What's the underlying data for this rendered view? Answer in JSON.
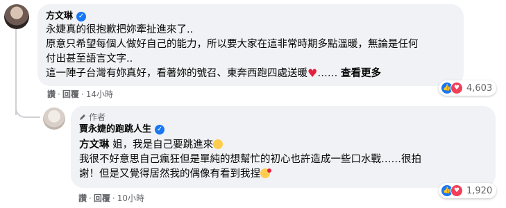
{
  "comment1": {
    "author": "方文琳",
    "lines": [
      "永婕真的很抱歉把妳牽扯進來了..",
      "原意只希望每個人做好自己的能力，所以要大家在這非常時期多點溫暖，無論是任何",
      "付出甚至語言文字..",
      "這一陣子台灣有妳真好，看著妳的號召、東奔西跑四處送暖"
    ],
    "ellipsis": "……",
    "see_more": "查看更多",
    "actions": {
      "like": "讚",
      "reply": "回覆",
      "time": "14小時"
    },
    "reaction_count": "4,603"
  },
  "reply1": {
    "badge": "作者",
    "author": "賈永婕的跑跳人生",
    "mention": "方文琳",
    "line1_rest": " 姐，我是自己要跳進來",
    "line2": "我很不好意思自己瘋狂但是單純的想幫忙的初心也許造成一些口水戰……很拍",
    "line3": "謝！但是又覺得居然我的偶像有看到我捏",
    "actions": {
      "like": "讚",
      "reply": "回覆",
      "time": "10小時"
    },
    "reaction_count": "1,920"
  },
  "colors": {
    "bubble": "#f0f2f5",
    "meta": "#65676b",
    "verified": "#1877f2",
    "love": "#f33e58"
  },
  "icons": [
    "verified-badge-icon",
    "heart-emoji-icon",
    "grin-emoji-icon",
    "kiss-emoji-icon",
    "like-reaction-icon",
    "love-reaction-icon",
    "pen-icon"
  ]
}
